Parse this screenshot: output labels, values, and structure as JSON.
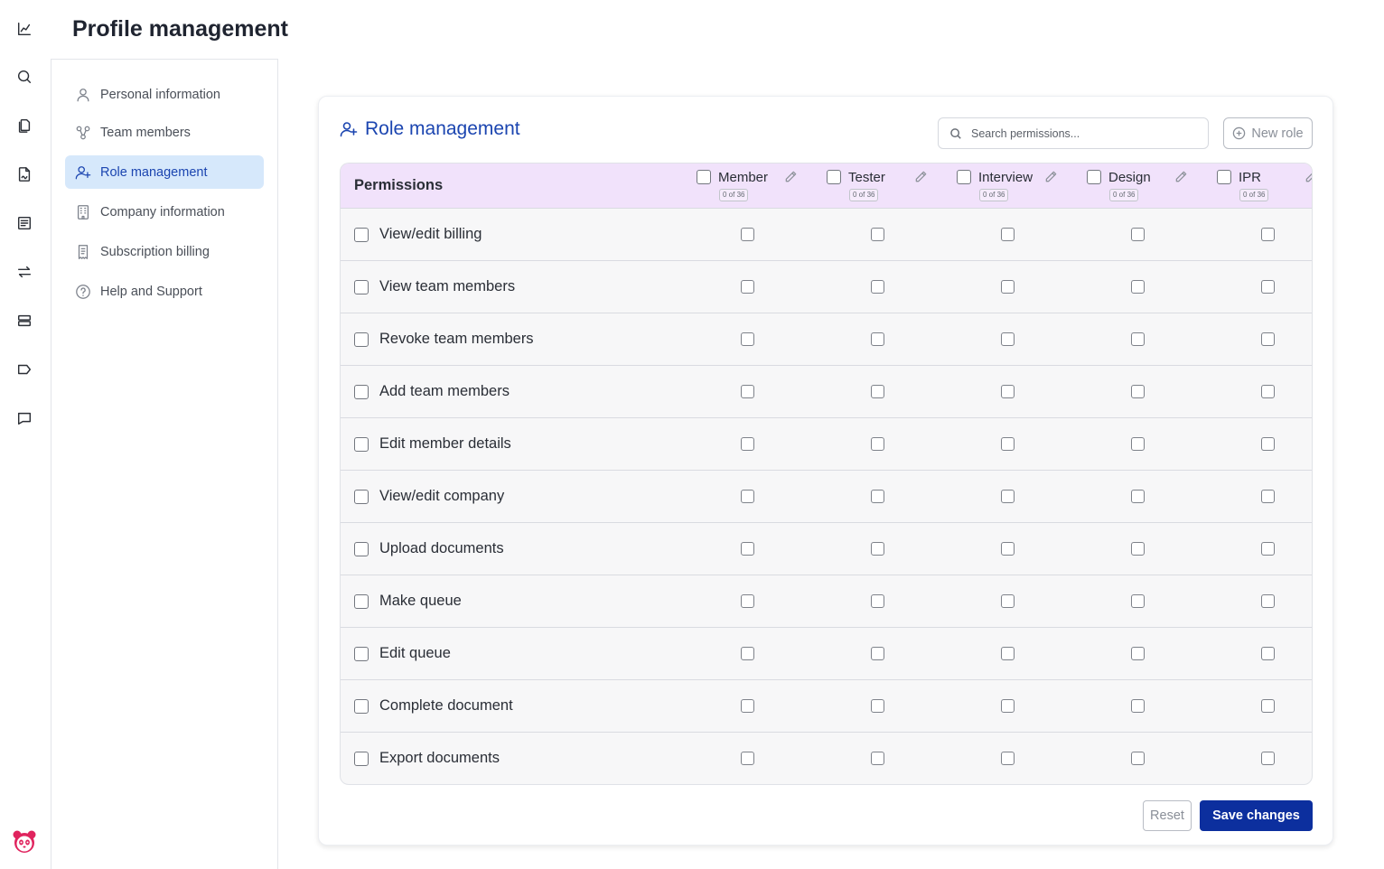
{
  "page": {
    "title": "Profile management"
  },
  "rail": {
    "icons": [
      "chart-line-icon",
      "search-icon",
      "documents-icon",
      "file-signature-icon",
      "list-icon",
      "transfer-icon",
      "server-icon",
      "tag-icon",
      "message-icon"
    ],
    "logo": "panda-logo"
  },
  "subnav": {
    "items": [
      {
        "label": "Personal information",
        "icon": "user-icon"
      },
      {
        "label": "Team members",
        "icon": "team-icon"
      },
      {
        "label": "Role management",
        "icon": "user-add-icon",
        "active": true
      },
      {
        "label": "Company information",
        "icon": "building-icon"
      },
      {
        "label": "Subscription billing",
        "icon": "receipt-icon"
      },
      {
        "label": "Help and Support",
        "icon": "help-icon"
      }
    ]
  },
  "card": {
    "title": "Role management",
    "search_placeholder": "Search permissions...",
    "new_role_label": "New role",
    "reset_label": "Reset",
    "save_label": "Save changes"
  },
  "table": {
    "header_label": "Permissions",
    "roles": [
      {
        "name": "Member",
        "count": "0 of 36"
      },
      {
        "name": "Tester",
        "count": "0 of 36"
      },
      {
        "name": "Interview",
        "count": "0 of 36"
      },
      {
        "name": "Design",
        "count": "0 of 36"
      },
      {
        "name": "IPR",
        "count": "0 of 36"
      }
    ],
    "permissions": [
      "View/edit billing",
      "View team members",
      "Revoke team members",
      "Add team members",
      "Edit member details",
      "View/edit company",
      "Upload documents",
      "Make queue",
      "Edit queue",
      "Complete document",
      "Export documents"
    ]
  },
  "colors": {
    "accent": "#1b45b0",
    "header_bg": "#f1e2fb",
    "active_nav_bg": "#d6e8fb",
    "save_button": "#0c2f9e"
  }
}
